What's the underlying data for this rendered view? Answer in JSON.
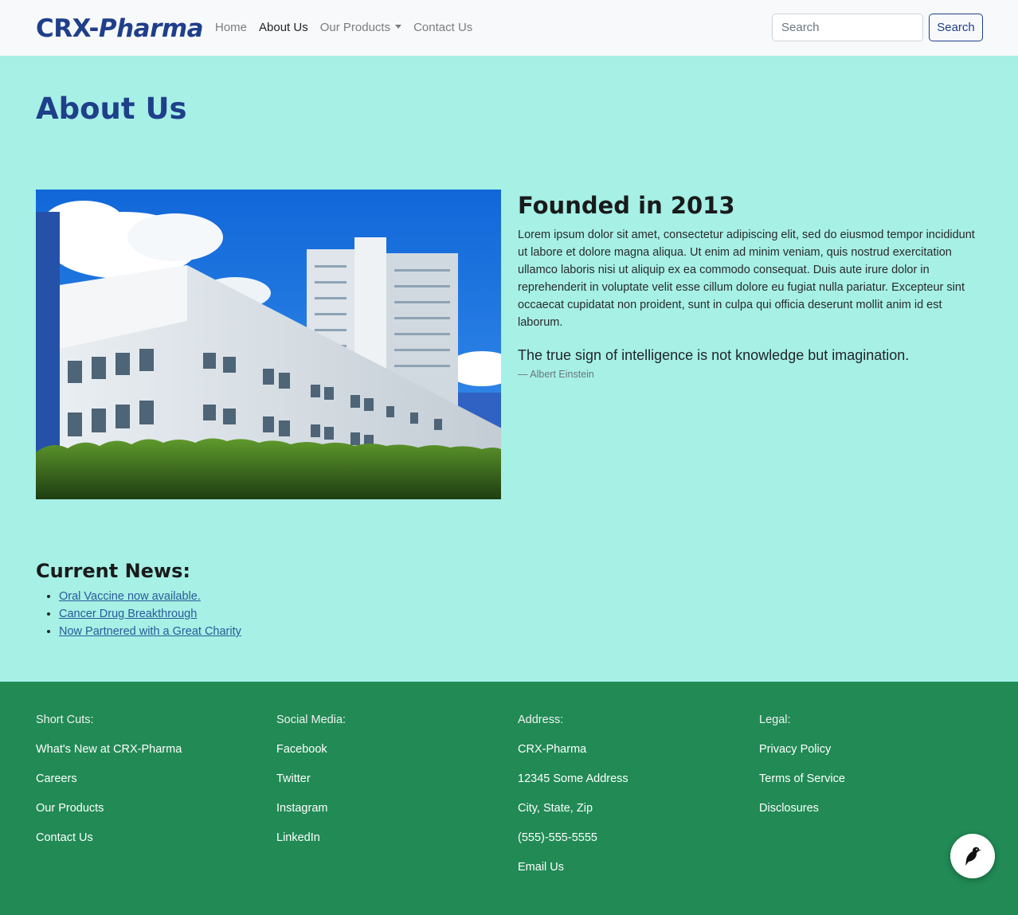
{
  "navbar": {
    "brand_part1": "CRX-",
    "brand_part2": "Pharma",
    "links": [
      {
        "label": "Home"
      },
      {
        "label": "About Us"
      },
      {
        "label": "Our Products"
      },
      {
        "label": "Contact Us"
      }
    ],
    "search_placeholder": "Search",
    "search_button": "Search"
  },
  "page": {
    "title": "About Us"
  },
  "about": {
    "heading": "Founded in 2013",
    "body": "Lorem ipsum dolor sit amet, consectetur adipiscing elit, sed do eiusmod tempor incididunt ut labore et dolore magna aliqua. Ut enim ad minim veniam, quis nostrud exercitation ullamco laboris nisi ut aliquip ex ea commodo consequat. Duis aute irure dolor in reprehenderit in voluptate velit esse cillum dolore eu fugiat nulla pariatur. Excepteur sint occaecat cupidatat non proident, sunt in culpa qui officia deserunt mollit anim id est laborum.",
    "quote": "The true sign of intelligence is not knowledge but imagination.",
    "quote_author": "— Albert Einstein"
  },
  "news": {
    "heading": "Current News:",
    "items": [
      "Oral Vaccine now available.",
      "Cancer Drug Breakthrough",
      "Now Partnered with a Great Charity"
    ]
  },
  "footer": {
    "shortcuts": {
      "heading": "Short Cuts:",
      "items": [
        "What's New at CRX-Pharma",
        "Careers",
        "Our Products",
        "Contact Us"
      ]
    },
    "social": {
      "heading": "Social Media:",
      "items": [
        "Facebook",
        "Twitter",
        "Instagram",
        "LinkedIn"
      ]
    },
    "address": {
      "heading": "Address:",
      "items": [
        "CRX-Pharma",
        "12345 Some Address",
        "City, State, Zip",
        "(555)-555-5555",
        "Email Us"
      ]
    },
    "legal": {
      "heading": "Legal:",
      "items": [
        "Privacy Policy",
        "Terms of Service",
        "Disclosures"
      ]
    }
  },
  "colors": {
    "brand": "#1f3f8a",
    "page_background": "#a6f0e6",
    "footer_background": "#218a55"
  }
}
